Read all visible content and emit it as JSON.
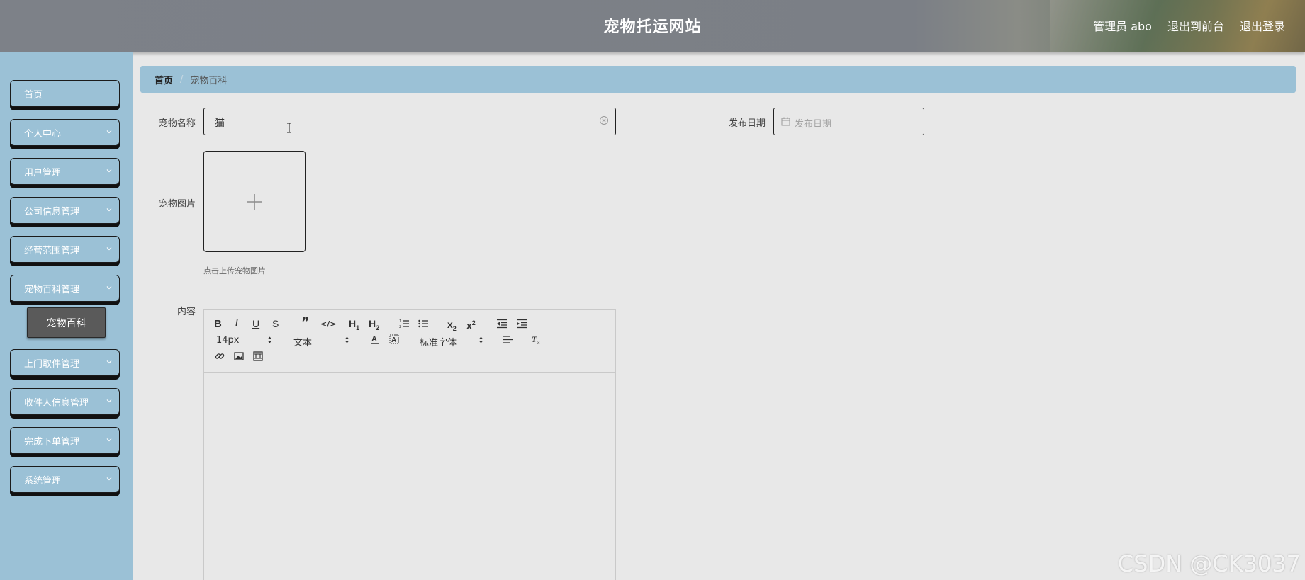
{
  "header": {
    "title": "宠物托运网站",
    "user_label": "管理员 abo",
    "to_front_label": "退出到前台",
    "logout_label": "退出登录"
  },
  "sidebar": {
    "items": [
      {
        "label": "首页",
        "has_chevron": false
      },
      {
        "label": "个人中心",
        "has_chevron": true
      },
      {
        "label": "用户管理",
        "has_chevron": true
      },
      {
        "label": "公司信息管理",
        "has_chevron": true
      },
      {
        "label": "经营范围管理",
        "has_chevron": true
      },
      {
        "label": "宠物百科管理",
        "has_chevron": true,
        "expanded": true
      },
      {
        "label": "上门取件管理",
        "has_chevron": true
      },
      {
        "label": "收件人信息管理",
        "has_chevron": true
      },
      {
        "label": "完成下单管理",
        "has_chevron": true
      },
      {
        "label": "系统管理",
        "has_chevron": true
      }
    ],
    "subitem": {
      "label": "宠物百科"
    }
  },
  "breadcrumb": {
    "home": "首页",
    "separator": "/",
    "current": "宠物百科"
  },
  "form": {
    "name_label": "宠物名称",
    "name_value": "猫",
    "date_label": "发布日期",
    "date_placeholder": "发布日期",
    "image_label": "宠物图片",
    "upload_hint": "点击上传宠物图片",
    "content_label": "内容"
  },
  "editor": {
    "font_size": "14px",
    "header_select": "文本",
    "font_family": "标准字体"
  },
  "watermark": "CSDN @CK3037",
  "colors": {
    "sidebar_bg": "#9bc1d6",
    "header_bg": "#7d8188",
    "page_bg": "#e8e8e8",
    "submenu_bg": "#5a5a5a"
  }
}
